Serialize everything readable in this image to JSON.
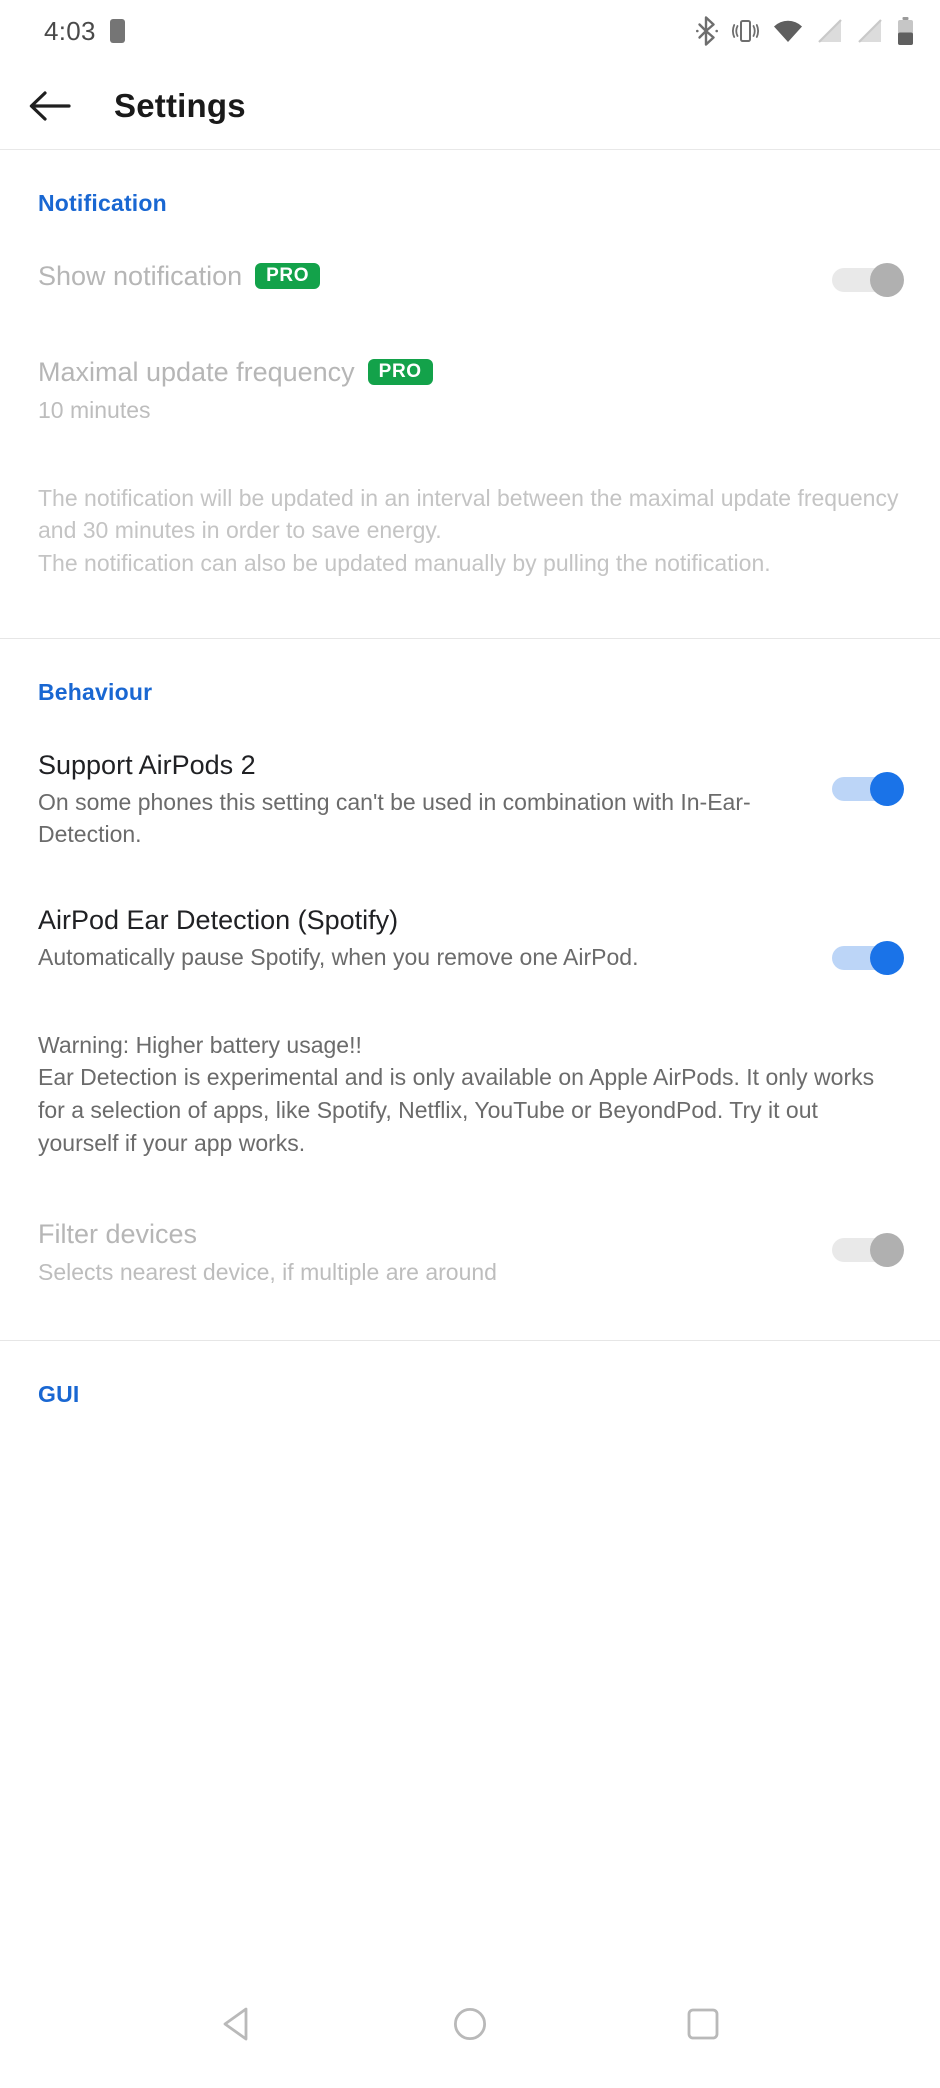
{
  "status_bar": {
    "time": "4:03",
    "left_icons": [
      "app-notification-icon"
    ],
    "right_icons": [
      "bluetooth-icon",
      "vibrate-icon",
      "wifi-icon",
      "no-signal-sim1-icon",
      "no-signal-sim2-icon",
      "battery-icon"
    ],
    "battery_level_percent": 40
  },
  "app_bar": {
    "back_label": "back-arrow",
    "title": "Settings"
  },
  "colors": {
    "accent_blue": "#1967d2",
    "switch_on": "#1a73e8",
    "switch_on_track": "#bcd5f7",
    "switch_off_thumb": "#b0b0b0",
    "switch_off_track": "#e9e9e9",
    "pro_green": "#13a24a",
    "title_text": "#202124",
    "subtitle_text": "#6b6b6b",
    "disabled_text": "#b6b6b6",
    "faded_paragraph": "#c4c4c4"
  },
  "sections": {
    "notification": {
      "header": "Notification",
      "rows": [
        {
          "title": "Show notification",
          "badge": "PRO",
          "subtitle": "",
          "switch_state": "off",
          "disabled": true
        },
        {
          "title": "Maximal update frequency",
          "badge": "PRO",
          "subtitle": "10 minutes",
          "switch_state": "none",
          "disabled": true
        }
      ],
      "description": "The notification will be updated in an interval between the maximal update frequency and 30 minutes in order to save energy.\nThe notification can also be updated manually by pulling the notification."
    },
    "behaviour": {
      "header": "Behaviour",
      "rows": [
        {
          "title": "Support AirPods 2",
          "badge": "",
          "subtitle": "On some phones this setting can't be used in combination with In-Ear-Detection.",
          "switch_state": "on",
          "disabled": false
        },
        {
          "title": "AirPod Ear Detection (Spotify)",
          "badge": "",
          "subtitle": "Automatically pause Spotify, when you remove one AirPod.",
          "switch_state": "on",
          "disabled": false
        }
      ],
      "description": "Warning: Higher battery usage!!\nEar Detection is experimental and is only available on Apple AirPods. It only works for a selection of apps, like Spotify, Netflix, YouTube or BeyondPod. Try it out yourself if your app works.",
      "filter_row": {
        "title": "Filter devices",
        "subtitle": "Selects nearest device, if multiple are around",
        "switch_state": "off",
        "disabled": true
      }
    },
    "gui": {
      "header": "GUI"
    }
  },
  "nav_bar": {
    "buttons": [
      "back-triangle-icon",
      "home-circle-icon",
      "recents-square-icon"
    ]
  }
}
